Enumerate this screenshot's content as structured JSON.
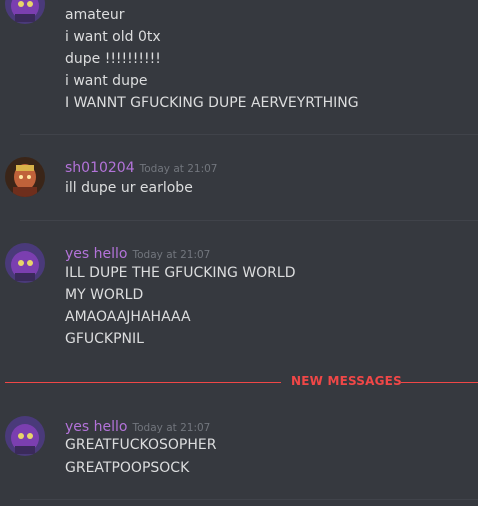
{
  "colors": {
    "background": "#36393f",
    "username": "#b373d9",
    "timestamp": "#72767d",
    "text": "#dcddde",
    "new_messages": "#f04747"
  },
  "messages": [
    {
      "username": "",
      "timestamp": "",
      "lines": [
        "amateur",
        "i want old 0tx",
        "dupe !!!!!!!!!!",
        "i want dupe",
        "I WANNT GFUCKING DUPE AERVEYRTHING"
      ]
    },
    {
      "username": "sh010204",
      "timestamp": "Today at 21:07",
      "lines": [
        "ill dupe ur earlobe"
      ]
    },
    {
      "username": "yes hello",
      "timestamp": "Today at 21:07",
      "lines": [
        "ILL DUPE THE GFUCKING WORLD",
        "MY WORLD",
        "AMAOAAJHAHAAA",
        "GFUCKPNIL"
      ]
    },
    {
      "username": "yes hello",
      "timestamp": "Today at 21:07",
      "lines": [
        "GREATFUCKOSOPHER",
        "GREATPOOPSOCK"
      ]
    }
  ],
  "new_messages_label": "NEW MESSAGES"
}
